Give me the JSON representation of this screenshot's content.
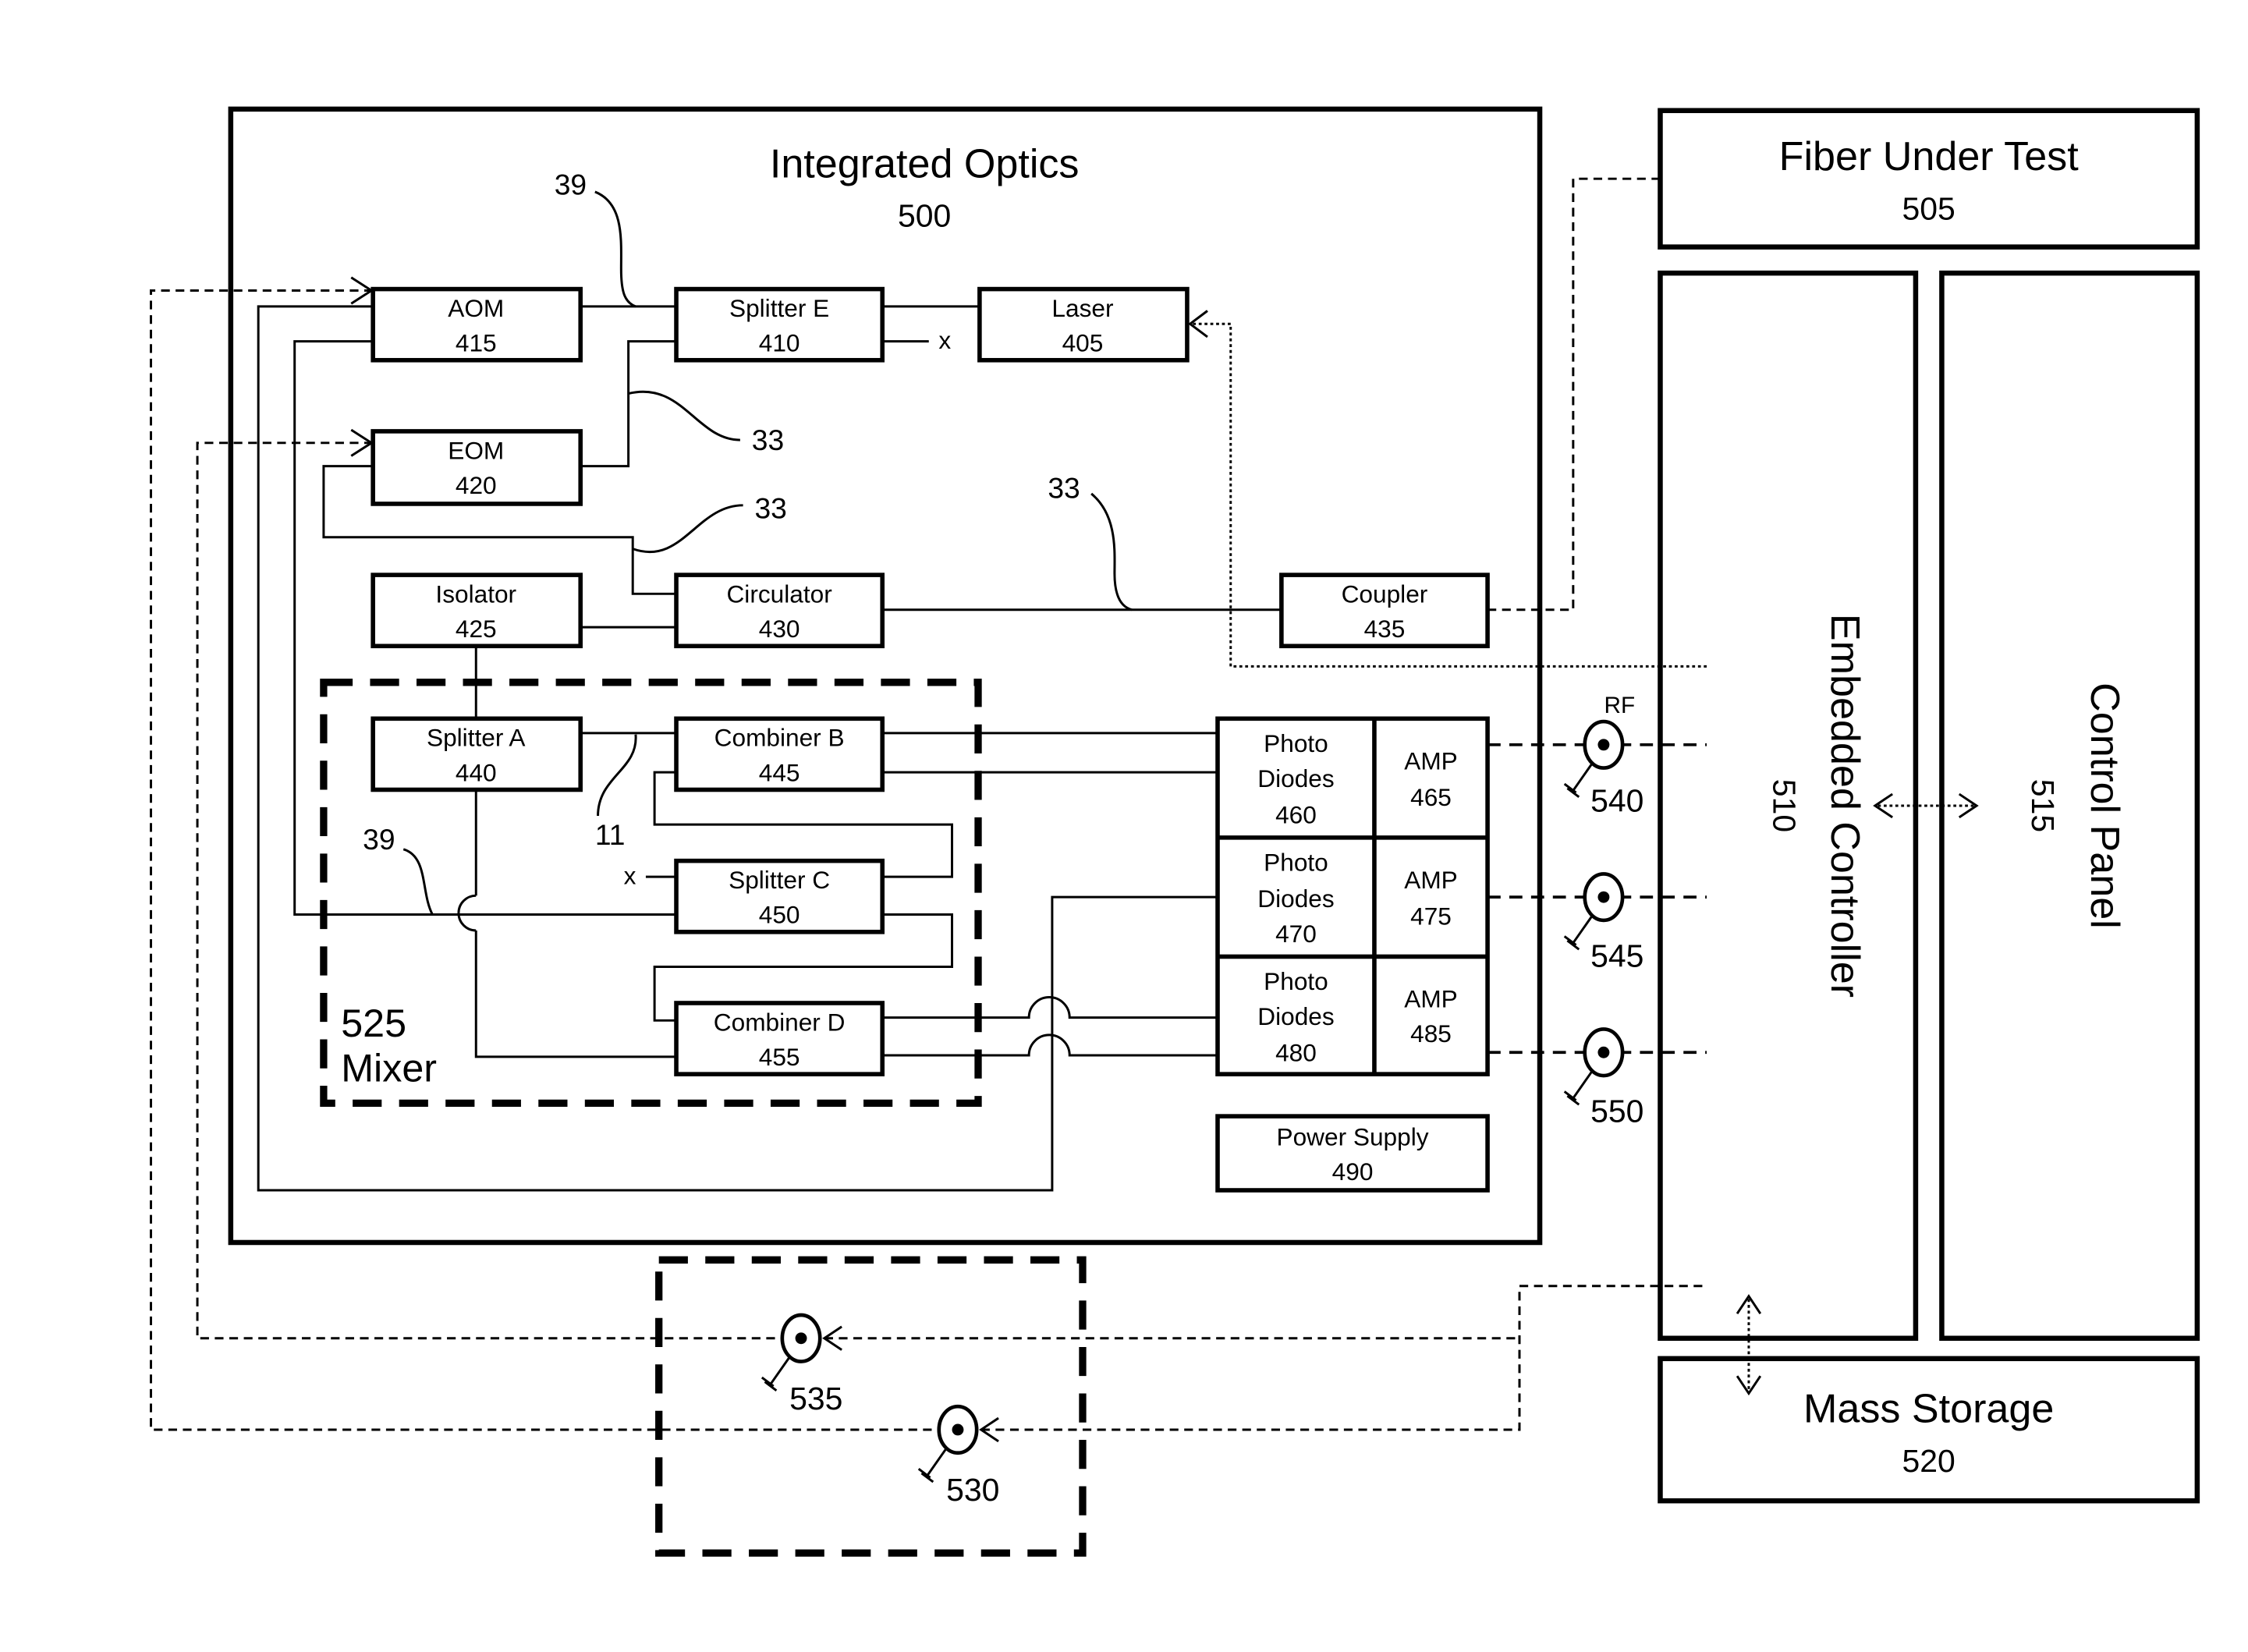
{
  "diagram": {
    "integrated_optics": {
      "title": "Integrated Optics",
      "number": "500"
    },
    "fiber_under_test": {
      "title": "Fiber Under Test",
      "number": "505"
    },
    "embedded_controller": {
      "title": "Embedded Controller",
      "number": "510"
    },
    "control_panel": {
      "title": "Control Panel",
      "number": "515"
    },
    "mass_storage": {
      "title": "Mass Storage",
      "number": "520"
    },
    "mixer": {
      "number": "525",
      "title": "Mixer"
    },
    "components": {
      "aom": {
        "title": "AOM",
        "number": "415"
      },
      "splitter_e": {
        "title": "Splitter E",
        "number": "410"
      },
      "laser": {
        "title": "Laser",
        "number": "405"
      },
      "eom": {
        "title": "EOM",
        "number": "420"
      },
      "isolator": {
        "title": "Isolator",
        "number": "425"
      },
      "circulator": {
        "title": "Circulator",
        "number": "430"
      },
      "coupler": {
        "title": "Coupler",
        "number": "435"
      },
      "splitter_a": {
        "title": "Splitter A",
        "number": "440"
      },
      "combiner_b": {
        "title": "Combiner B",
        "number": "445"
      },
      "splitter_c": {
        "title": "Splitter C",
        "number": "450"
      },
      "combiner_d": {
        "title": "Combiner D",
        "number": "455"
      },
      "photodiodes_460": {
        "line1": "Photo",
        "line2": "Diodes",
        "number": "460"
      },
      "amp_465": {
        "title": "AMP",
        "number": "465"
      },
      "photodiodes_470": {
        "line1": "Photo",
        "line2": "Diodes",
        "number": "470"
      },
      "amp_475": {
        "title": "AMP",
        "number": "475"
      },
      "photodiodes_480": {
        "line1": "Photo",
        "line2": "Diodes",
        "number": "480"
      },
      "amp_485": {
        "title": "AMP",
        "number": "485"
      },
      "power_supply": {
        "title": "Power Supply",
        "number": "490"
      }
    },
    "connectors": {
      "rf_label": "RF",
      "c540": "540",
      "c545": "545",
      "c550": "550",
      "c535": "535",
      "c530": "530"
    },
    "fiber_labels": {
      "l39_top": "39",
      "l33_a": "33",
      "l33_b": "33",
      "l33_c": "33",
      "l11": "11",
      "l39_bottom": "39"
    },
    "terminations": {
      "x1": "x",
      "x2": "x"
    }
  }
}
